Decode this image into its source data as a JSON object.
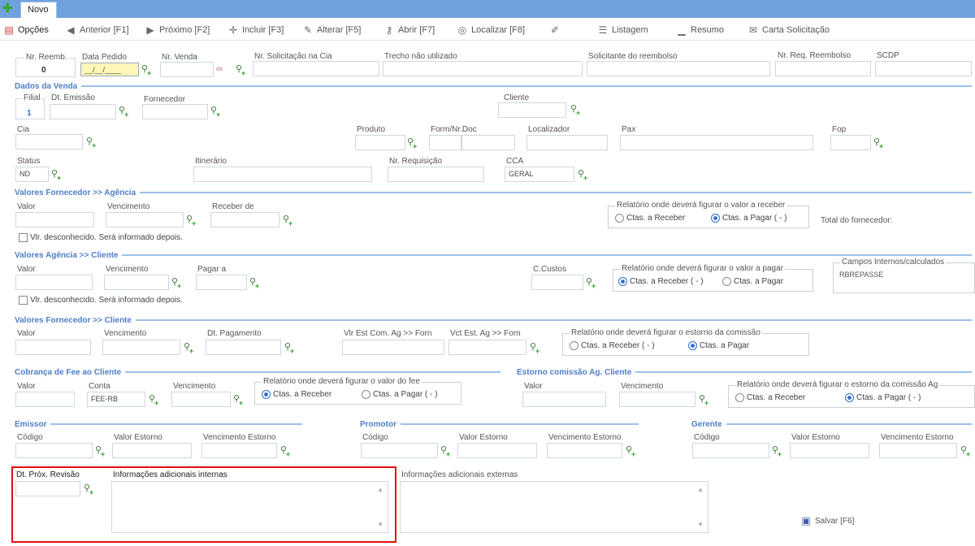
{
  "tabs": {
    "new_tab": "Novo"
  },
  "toolbar": {
    "opcoes": "Opções",
    "anterior": "Anterior [F1]",
    "proximo": "Próximo [F2]",
    "incluir": "Incluir [F3]",
    "alterar": "Alterar [F5]",
    "abrir": "Abrir [F7]",
    "localizar": "Localizar [F8]",
    "listagem": "Listagem",
    "resumo": "Resumo",
    "carta": "Carta Solicitação"
  },
  "header": {
    "nr_reemb_label": "Nr. Reemb.",
    "nr_reemb_value": "0",
    "data_pedido_label": "Data Pedido",
    "data_pedido_value": "__/__/____",
    "nr_venda_label": "Nr. Venda",
    "nr_solicitacao_label": "Nr. Solicitação na Cia",
    "trecho_label": "Trecho não utilizado",
    "solicitante_label": "Solicitante do reembolso",
    "nr_req_label": "Nr. Req. Reembolso",
    "scdp_label": "SCDP"
  },
  "dados_venda": {
    "title": "Dados da Venda",
    "filial_label": "Filial",
    "filial_value": "1",
    "dt_emissao_label": "Dt. Emissão",
    "fornecedor_label": "Fornecedor",
    "cliente_label": "Cliente",
    "cia_label": "Cia",
    "produto_label": "Produto",
    "form_label": "Form/Nr.Doc",
    "localizador_label": "Localizador",
    "pax_label": "Pax",
    "fop_label": "Fop",
    "status_label": "Status",
    "status_value": "ND",
    "itinerario_label": "Itinerário",
    "nr_requisicao_label": "Nr. Requisição",
    "cca_label": "CCA",
    "cca_value": "GERAL"
  },
  "forn_agencia": {
    "title": "Valores Fornecedor >> Agência",
    "valor_label": "Valor",
    "vencimento_label": "Vencimento",
    "receber_label": "Receber de",
    "group_title": "Relatório onde deverá figurar o valor a receber",
    "opt1": "Ctas. a Receber",
    "opt2": "Ctas. a Pagar ( - )",
    "total_label": "Total do fornecedor:",
    "check_label": "Vlr. desconhecido. Será informado depois."
  },
  "agencia_cliente": {
    "title": "Valores Agência >> Cliente",
    "valor_label": "Valor",
    "vencimento_label": "Vencimento",
    "pagar_label": "Pagar a",
    "ccustos_label": "C.Custos",
    "group_title": "Relatório onde deverá figurar o valor a pagar",
    "opt1": "Ctas. a Receber ( - )",
    "opt2": "Ctas. a Pagar",
    "campos_title": "Campos Internos/calculados",
    "campos_value": "RBREPASSE",
    "check_label": "Vlr. desconhecido. Será informado depois."
  },
  "forn_cliente": {
    "title": "Valores Fornecedor >> Cliente",
    "valor_label": "Valor",
    "vencimento_label": "Vencimento",
    "dt_pag_label": "Dt. Pagamento",
    "vlr_est_label": "Vlr Est Com. Ag >> Forn",
    "vct_est_label": "Vct Est. Ag >> Forn",
    "group_title": "Relatório onde deverá figurar o estorno da comissão",
    "opt1": "Ctas. a Receber ( - )",
    "opt2": "Ctas. a Pagar"
  },
  "fee": {
    "title": "Cobrança de Fee ao Cliente",
    "valor_label": "Valor",
    "conta_label": "Conta",
    "conta_value": "FEE-RB",
    "vencimento_label": "Vencimento",
    "group_title": "Relatório onde deverá figurar o valor do fee",
    "opt1": "Ctas. a Receber",
    "opt2": "Ctas. a Pagar ( - )"
  },
  "estorno": {
    "title": "Estorno comissão Ag. Cliente",
    "valor_label": "Valor",
    "vencimento_label": "Vencimento",
    "group_title": "Relatório onde deverá figurar o estorno da comissão Ag",
    "opt1": "Ctas. a Receber",
    "opt2": "Ctas. a Pagar ( - )"
  },
  "emissor": {
    "title": "Emissor",
    "codigo_label": "Código",
    "valor_label": "Valor Estorno",
    "vencimento_label": "Vencimento Estorno"
  },
  "promotor": {
    "title": "Promotor",
    "codigo_label": "Código",
    "valor_label": "Valor Estorno",
    "vencimento_label": "Vencimento Estorno"
  },
  "gerente": {
    "title": "Gerente",
    "codigo_label": "Código",
    "valor_label": "Valor Estorno",
    "vencimento_label": "Vencimento Estorno"
  },
  "bottom": {
    "revisao_label": "Dt. Próx. Revisão",
    "info_internas_label": "Informações adicionais internas",
    "info_externas_label": "Informações adicionais externas",
    "salvar_label": "Salvar [F6]"
  },
  "colors": {
    "top_bar": "#6fa1de",
    "section_title": "#4f7fc6",
    "highlight": "#e01010"
  }
}
